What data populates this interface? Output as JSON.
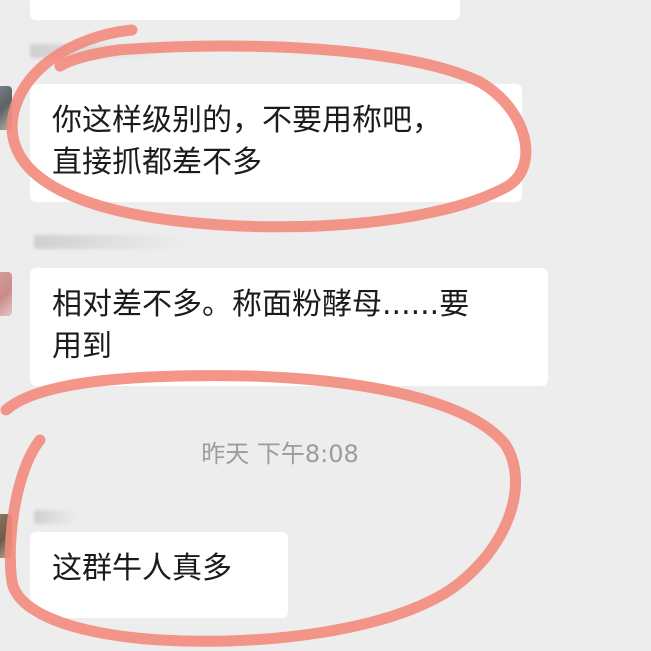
{
  "messages": [
    {
      "lines": [
        "你这样级别的，不要用称吧，",
        "直接抓都差不多"
      ]
    },
    {
      "lines": [
        "相对差不多。称面粉酵母......要",
        "用到"
      ]
    },
    {
      "lines": [
        "这群牛人真多"
      ]
    }
  ],
  "timestamp": "昨天 下午8:08",
  "colors": {
    "background": "#ededed",
    "bubble": "#ffffff",
    "text": "#1b1b1b",
    "timestamp": "#9c9c9c",
    "annotation": "#f2897c"
  }
}
